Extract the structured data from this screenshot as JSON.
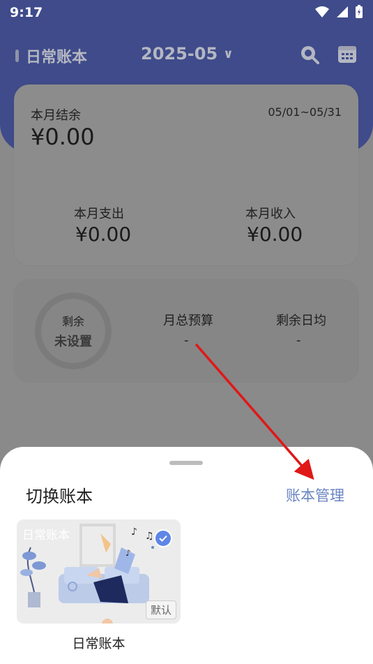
{
  "status_bar": {
    "time": "9:17"
  },
  "header": {
    "book_name": "日常账本",
    "month": "2025-05"
  },
  "balance_card": {
    "title": "本月结余",
    "range": "05/01~05/31",
    "balance": "¥0.00",
    "expense_label": "本月支出",
    "expense": "¥0.00",
    "income_label": "本月收入",
    "income": "¥0.00"
  },
  "budget_card": {
    "ring_label": "剩余",
    "ring_value": "未设置",
    "total_budget_label": "月总预算",
    "total_budget_value": "-",
    "daily_avg_label": "剩余日均",
    "daily_avg_value": "-"
  },
  "sheet": {
    "title": "切换账本",
    "manage_label": "账本管理",
    "books": [
      {
        "name": "日常账本",
        "badge": "默认",
        "selected": true
      }
    ]
  },
  "colors": {
    "header_bg": "#3f4b8a",
    "accent": "#6a84c2",
    "arrow": "#e01818"
  }
}
